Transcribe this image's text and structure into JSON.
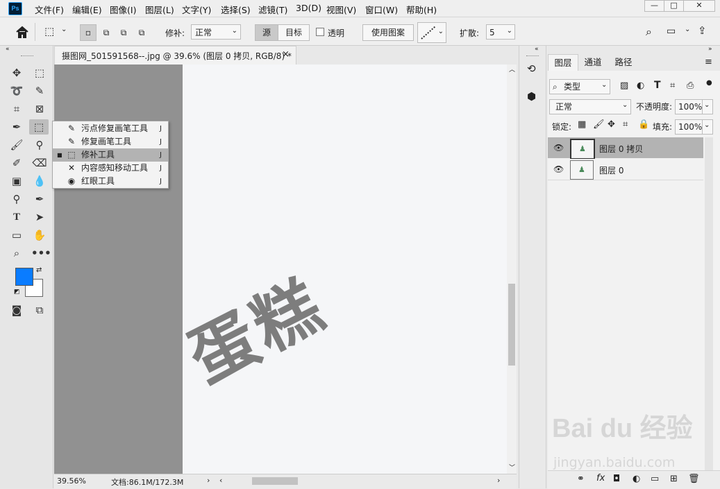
{
  "app": {
    "logo": "Ps"
  },
  "menu": [
    "文件(F)",
    "编辑(E)",
    "图像(I)",
    "图层(L)",
    "文字(Y)",
    "选择(S)",
    "滤镜(T)",
    "3D(D)",
    "视图(V)",
    "窗口(W)",
    "帮助(H)"
  ],
  "window_controls": {
    "minimize": "—",
    "maximize": "□",
    "close": "✕"
  },
  "options": {
    "patch_label": "修补:",
    "patch_mode": "正常",
    "source": "源",
    "target": "目标",
    "transparent": "透明",
    "use_pattern": "使用图案",
    "diffuse_label": "扩散:",
    "diffuse_value": "5"
  },
  "doc_tab": {
    "title": "摄图网_501591568--.jpg @ 39.6% (图层 0 拷贝, RGB/8) *",
    "close": "×"
  },
  "flyout": [
    {
      "label": "污点修复画笔工具",
      "key": "J",
      "icon": "spot-healing-brush-icon",
      "glyph": "✎"
    },
    {
      "label": "修复画笔工具",
      "key": "J",
      "icon": "healing-brush-icon",
      "glyph": "✎"
    },
    {
      "label": "修补工具",
      "key": "J",
      "icon": "patch-tool-icon",
      "glyph": "⬚",
      "selected": true
    },
    {
      "label": "内容感知移动工具",
      "key": "J",
      "icon": "content-aware-move-icon",
      "glyph": "✕"
    },
    {
      "label": "红眼工具",
      "key": "J",
      "icon": "red-eye-icon",
      "glyph": "◉"
    }
  ],
  "canvas": {
    "text": "蛋糕"
  },
  "status": {
    "zoom": "39.56%",
    "doc_info": "文档:86.1M/172.3M"
  },
  "panel_tabs": [
    "图层",
    "通道",
    "路径"
  ],
  "layers_panel": {
    "filter_kind": "类型",
    "blend_mode": "正常",
    "opacity_label": "不透明度:",
    "opacity_value": "100%",
    "lock_label": "锁定:",
    "fill_label": "填充:",
    "fill_value": "100%",
    "layers": [
      {
        "name": "图层 0 拷贝",
        "selected": true
      },
      {
        "name": "图层 0",
        "selected": false
      }
    ]
  },
  "watermark": {
    "text": "Bai du 经验",
    "url": "jingyan.baidu.com"
  },
  "colors": {
    "foreground": "#0a7cff",
    "background": "#ffffff",
    "accent": "#31a8ff",
    "canvas_text": "#7d7d7d"
  }
}
